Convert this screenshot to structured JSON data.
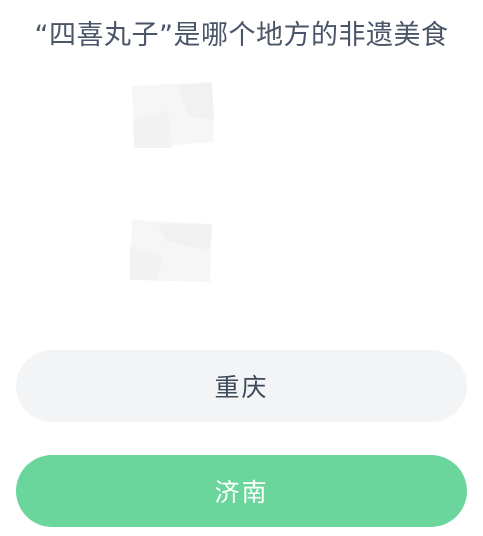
{
  "question": {
    "text": "“四喜丸子”是哪个地方的非遗美食"
  },
  "images": [
    {
      "icon": "broken-image-icon"
    },
    {
      "icon": "broken-image-icon"
    }
  ],
  "options": [
    {
      "label": "重庆",
      "state": "default",
      "background": "#f3f4f6",
      "color": "#3d4a5c"
    },
    {
      "label": "济南",
      "state": "correct",
      "background": "#6ad69c",
      "color": "#ffffff"
    }
  ]
}
